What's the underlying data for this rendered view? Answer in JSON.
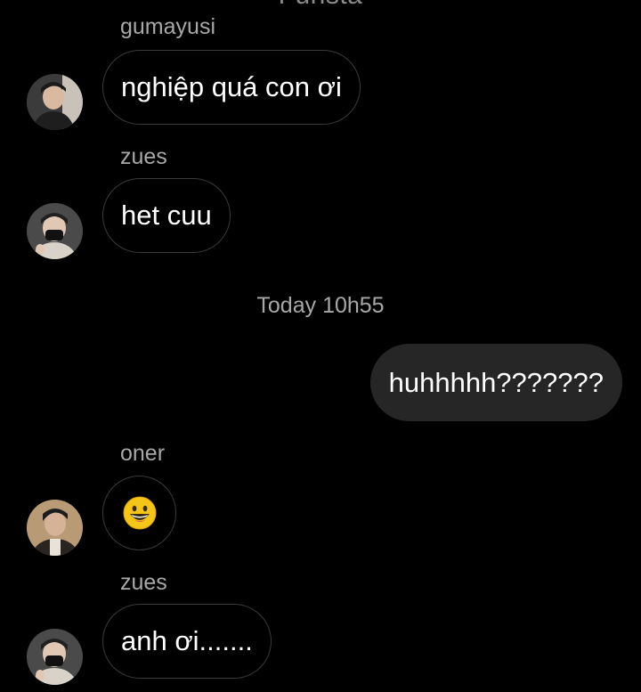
{
  "header": {
    "title_cut": "Funsta"
  },
  "messages": [
    {
      "sender": "gumayusi",
      "text": "nghiệp quá con ơi"
    },
    {
      "sender": "zues",
      "text": "het cuu"
    },
    {
      "sender": "oner",
      "emoji": "grinning-face"
    },
    {
      "sender": "zues",
      "text": "anh ơi......."
    }
  ],
  "timestamp": "Today 10h55",
  "outgoing": {
    "text": "huhhhhh???????"
  },
  "colors": {
    "background": "#000000",
    "incoming_bubble_border": "#3a3a3a",
    "outgoing_bubble": "#262626",
    "sender_label": "#a8a8a8",
    "emoji_yellow": "#f5c518"
  }
}
